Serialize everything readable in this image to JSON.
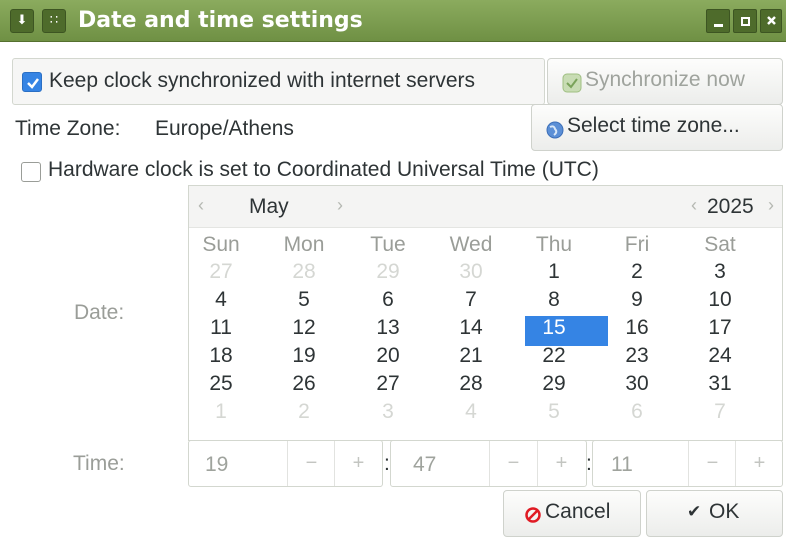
{
  "window": {
    "title": "Date and time settings",
    "menu_icon_glyph": "⬇",
    "grip_icon_glyph": "∷"
  },
  "sync": {
    "checkbox_label": "Keep clock synchronized with internet servers",
    "checked": true,
    "sync_now_label": "Synchronize now"
  },
  "timezone": {
    "label": "Time Zone:",
    "value": "Europe/Athens",
    "select_button_label": "Select time zone..."
  },
  "hardware_clock": {
    "label": "Hardware clock is set to Coordinated Universal Time (UTC)",
    "checked": false
  },
  "date": {
    "label": "Date:",
    "month": "May",
    "year": "2025",
    "prev_glyph": "‹",
    "next_glyph": "›",
    "weekdays": [
      "Sun",
      "Mon",
      "Tue",
      "Wed",
      "Thu",
      "Fri",
      "Sat"
    ],
    "weeks": [
      [
        "27",
        "28",
        "29",
        "30",
        "1",
        "2",
        "3"
      ],
      [
        "4",
        "5",
        "6",
        "7",
        "8",
        "9",
        "10"
      ],
      [
        "11",
        "12",
        "13",
        "14",
        "15",
        "16",
        "17"
      ],
      [
        "18",
        "19",
        "20",
        "21",
        "22",
        "23",
        "24"
      ],
      [
        "25",
        "26",
        "27",
        "28",
        "29",
        "30",
        "31"
      ],
      [
        "1",
        "2",
        "3",
        "4",
        "5",
        "6",
        "7"
      ]
    ],
    "selected_day": "15"
  },
  "time": {
    "label": "Time:",
    "hours": "19",
    "minutes": "47",
    "seconds": "11",
    "separator": ":",
    "minus": "−",
    "plus": "+"
  },
  "actions": {
    "cancel_label": "Cancel",
    "ok_label": "OK",
    "ok_glyph": "✔"
  },
  "colors": {
    "titlebar": "#7a9a4e",
    "accent": "#3584e4",
    "cancel_icon": "#e01b24"
  },
  "icons": {
    "menu": "download-icon",
    "grip": "grip-icon",
    "minimize": "minimize-icon",
    "maximize": "maximize-icon",
    "close": "close-icon",
    "sync": "clock-sync-icon",
    "timezone": "globe-icon",
    "cancel": "cancel-icon",
    "ok": "checkmark-icon"
  }
}
